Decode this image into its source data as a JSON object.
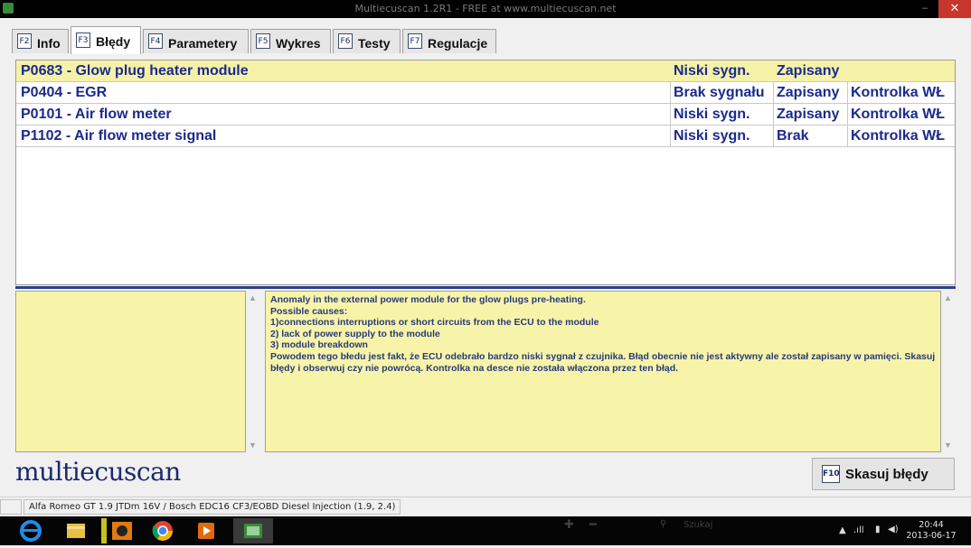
{
  "window": {
    "title": "Multiecuscan 1.2R1 - FREE at www.multiecuscan.net",
    "close": "✕",
    "minimize": "–",
    "maximize": "▫"
  },
  "tabs": [
    {
      "key": "F2",
      "label": "Info"
    },
    {
      "key": "F3",
      "label": "Błędy"
    },
    {
      "key": "F4",
      "label": "Parametery"
    },
    {
      "key": "F5",
      "label": "Wykres"
    },
    {
      "key": "F6",
      "label": "Testy"
    },
    {
      "key": "F7",
      "label": "Regulacje"
    }
  ],
  "codes": [
    {
      "code": "P0683 - Glow plug heater module",
      "signal": "Niski sygn.",
      "status": "Zapisany",
      "lamp": ""
    },
    {
      "code": "P0404 - EGR",
      "signal": "Brak sygnału",
      "status": "Zapisany",
      "lamp": "Kontrolka WŁ"
    },
    {
      "code": "P0101 - Air flow meter",
      "signal": "Niski sygn.",
      "status": "Zapisany",
      "lamp": "Kontrolka WŁ"
    },
    {
      "code": "P1102 - Air flow meter signal",
      "signal": "Niski sygn.",
      "status": "Brak",
      "lamp": "Kontrolka WŁ"
    }
  ],
  "description": {
    "lines": [
      "Anomaly in the external power module for the glow plugs pre-heating.",
      "Possible causes:",
      "1)connections interruptions or short circuits from the ECU to the module",
      "2) lack of power supply to the module",
      "3) module breakdown",
      "Powodem tego błedu jest fakt, że ECU odebrało bardzo niski sygnał z czujnika. Błąd obecnie nie jest aktywny ale został zapisany w pamięci. Skasuj błędy i obserwuj czy nie powrócą. Kontrolka na desce nie została włączona przez ten błąd."
    ]
  },
  "logo": "multiecuscan",
  "clear_button": {
    "key": "F10",
    "label": "Skasuj błędy"
  },
  "status": {
    "vehicle": "Alfa Romeo GT 1.9 JTDm 16V / Bosch EDC16 CF3/EOBD Diesel Injection (1.9, 2.4)"
  },
  "taskbar": {
    "time": "20:44",
    "date": "2013-06-17",
    "search_placeholder": "Szukaj",
    "tray_arrow": "▲",
    "signal": ".ıll",
    "battery": "▮",
    "volume": "◀)"
  },
  "colors": {
    "accent": "#1b2a8c",
    "selected_row": "#f5f2a8",
    "panel": "#f7f4a9",
    "close": "#c7362c"
  }
}
